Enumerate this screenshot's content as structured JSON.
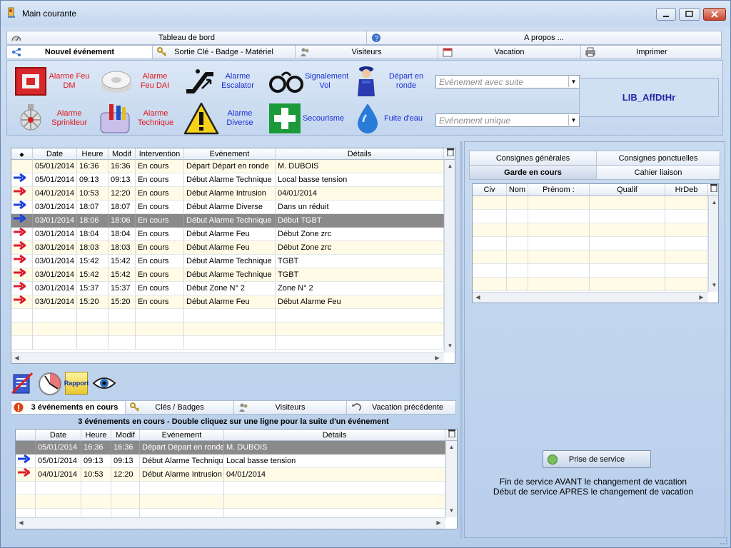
{
  "window": {
    "title": "Main courante"
  },
  "menu_tabs": {
    "row1": [
      {
        "label": "Tableau de bord",
        "icon": "dashboard-icon"
      },
      {
        "label": "A propos ...",
        "icon": "help-icon"
      }
    ],
    "row2": [
      {
        "label": "Nouvel événement",
        "icon": "share-icon",
        "active": true
      },
      {
        "label": "Sortie Clé - Badge - Matériel",
        "icon": "keys-icon"
      },
      {
        "label": "Visiteurs",
        "icon": "visitors-icon"
      },
      {
        "label": "Vacation",
        "icon": "calendar-icon"
      },
      {
        "label": "Imprimer",
        "icon": "printer-icon"
      }
    ]
  },
  "toolbar": {
    "alarm_buttons": [
      {
        "label": "Alarme Feu DM",
        "icon": "fire-alarm-button-icon"
      },
      {
        "label": "Alarme Feu DAI",
        "icon": "smoke-detector-icon"
      },
      {
        "label": "Alarme Sprinkleur",
        "icon": "sprinkler-icon"
      },
      {
        "label": "Alarme Technique",
        "icon": "technical-tools-icon"
      }
    ],
    "event_buttons": [
      {
        "label": "Alarme Escalator",
        "icon": "escalator-icon"
      },
      {
        "label": "Signalement Vol",
        "icon": "handcuffs-icon"
      },
      {
        "label": "Départ en ronde",
        "icon": "guard-icon"
      },
      {
        "label": "Alarme Diverse",
        "icon": "warning-icon"
      },
      {
        "label": "Secourisme",
        "icon": "first-aid-icon"
      },
      {
        "label": "Fuite d'eau",
        "icon": "water-drop-icon"
      }
    ],
    "combo_suite_placeholder": "Evénement avec suite",
    "combo_unique_placeholder": "Evénement unique",
    "lib_label": "LIB_AffDtHr"
  },
  "events_grid": {
    "headers": [
      "Date",
      "Heure",
      "Modif",
      "Intervention",
      "Evénement",
      "Détails"
    ],
    "rows": [
      {
        "arrow": "",
        "date": "05/01/2014",
        "heure": "16:36",
        "modif": "16:36",
        "intervention": "En cours",
        "evenement": "Départ Départ en ronde",
        "details": "M. DUBOIS"
      },
      {
        "arrow": "blue",
        "date": "05/01/2014",
        "heure": "09:13",
        "modif": "09:13",
        "intervention": "En cours",
        "evenement": "Début Alarme Technique",
        "details": "Local basse tension"
      },
      {
        "arrow": "red",
        "date": "04/01/2014",
        "heure": "10:53",
        "modif": "12:20",
        "intervention": "En cours",
        "evenement": "Début Alarme Intrusion",
        "details": "04/01/2014"
      },
      {
        "arrow": "blue",
        "date": "03/01/2014",
        "heure": "18:07",
        "modif": "18:07",
        "intervention": "En cours",
        "evenement": "Début Alarme Diverse",
        "details": "Dans un réduit"
      },
      {
        "arrow": "blue",
        "date": "03/01/2014",
        "heure": "18:06",
        "modif": "18:06",
        "intervention": "En cours",
        "evenement": "Début Alarme Technique",
        "details": "Début TGBT",
        "selected": true
      },
      {
        "arrow": "red",
        "date": "03/01/2014",
        "heure": "18:04",
        "modif": "18:04",
        "intervention": "En cours",
        "evenement": "Début Alarme Feu",
        "details": "Début Zone zrc"
      },
      {
        "arrow": "red",
        "date": "03/01/2014",
        "heure": "18:03",
        "modif": "18:03",
        "intervention": "En cours",
        "evenement": "Début Alarme Feu",
        "details": "Début Zone zrc"
      },
      {
        "arrow": "red",
        "date": "03/01/2014",
        "heure": "15:42",
        "modif": "15:42",
        "intervention": "En cours",
        "evenement": "Début Alarme Technique",
        "details": "TGBT"
      },
      {
        "arrow": "red",
        "date": "03/01/2014",
        "heure": "15:42",
        "modif": "15:42",
        "intervention": "En cours",
        "evenement": "Début Alarme Technique",
        "details": "TGBT"
      },
      {
        "arrow": "red",
        "date": "03/01/2014",
        "heure": "15:37",
        "modif": "15:37",
        "intervention": "En cours",
        "evenement": "Début Zone N° 2",
        "details": "Zone N° 2"
      },
      {
        "arrow": "red",
        "date": "03/01/2014",
        "heure": "15:20",
        "modif": "15:20",
        "intervention": "En cours",
        "evenement": "Début Alarme Feu",
        "details": "Début Alarme Feu"
      }
    ]
  },
  "action_icons": [
    {
      "name": "cancel-report-icon"
    },
    {
      "name": "clock-icon"
    },
    {
      "name": "rapport-icon",
      "label": "Rapport"
    },
    {
      "name": "eye-icon"
    }
  ],
  "bottom_tabs": [
    {
      "label": "3 événements en cours",
      "icon": "alert-icon",
      "active": true
    },
    {
      "label": "Clés / Badges",
      "icon": "keys-icon"
    },
    {
      "label": "Visiteurs",
      "icon": "visitors-icon"
    },
    {
      "label": "Vacation précédente",
      "icon": "previous-icon"
    }
  ],
  "current_events": {
    "caption": "3 événements en cours - Double cliquez sur une ligne pour la suite d'un événement",
    "headers": [
      "Date",
      "Heure",
      "Modif",
      "Evénement",
      "Détails"
    ],
    "rows": [
      {
        "arrow": "",
        "date": "05/01/2014",
        "heure": "16:36",
        "modif": "16:36",
        "evenement": "Départ Départ en ronde",
        "details": "M. DUBOIS",
        "selected": true
      },
      {
        "arrow": "blue",
        "date": "05/01/2014",
        "heure": "09:13",
        "modif": "09:13",
        "evenement": "Début Alarme Technique",
        "details": "Local basse tension"
      },
      {
        "arrow": "red",
        "date": "04/01/2014",
        "heure": "10:53",
        "modif": "12:20",
        "evenement": "Début Alarme Intrusion",
        "details": "04/01/2014"
      }
    ]
  },
  "right_tabs": {
    "row1": [
      {
        "label": "Consignes générales"
      },
      {
        "label": "Consignes ponctuelles"
      }
    ],
    "row2": [
      {
        "label": "Garde en cours",
        "active": true
      },
      {
        "label": "Cahier liaison"
      }
    ]
  },
  "staff_grid": {
    "headers": [
      "Civ",
      "Nom",
      "Prénom :",
      "Qualif",
      "HrDeb"
    ]
  },
  "service": {
    "button_label": "Prise de service",
    "info_line1": "Fin de service AVANT le changement de vacation",
    "info_line2": "Début de service APRES le changement de vacation"
  },
  "colors": {
    "arrow_red": "#e01a2a",
    "arrow_blue": "#1a3fe0",
    "selected_row": "#8a8a8a",
    "odd_row": "#fffbe6"
  }
}
